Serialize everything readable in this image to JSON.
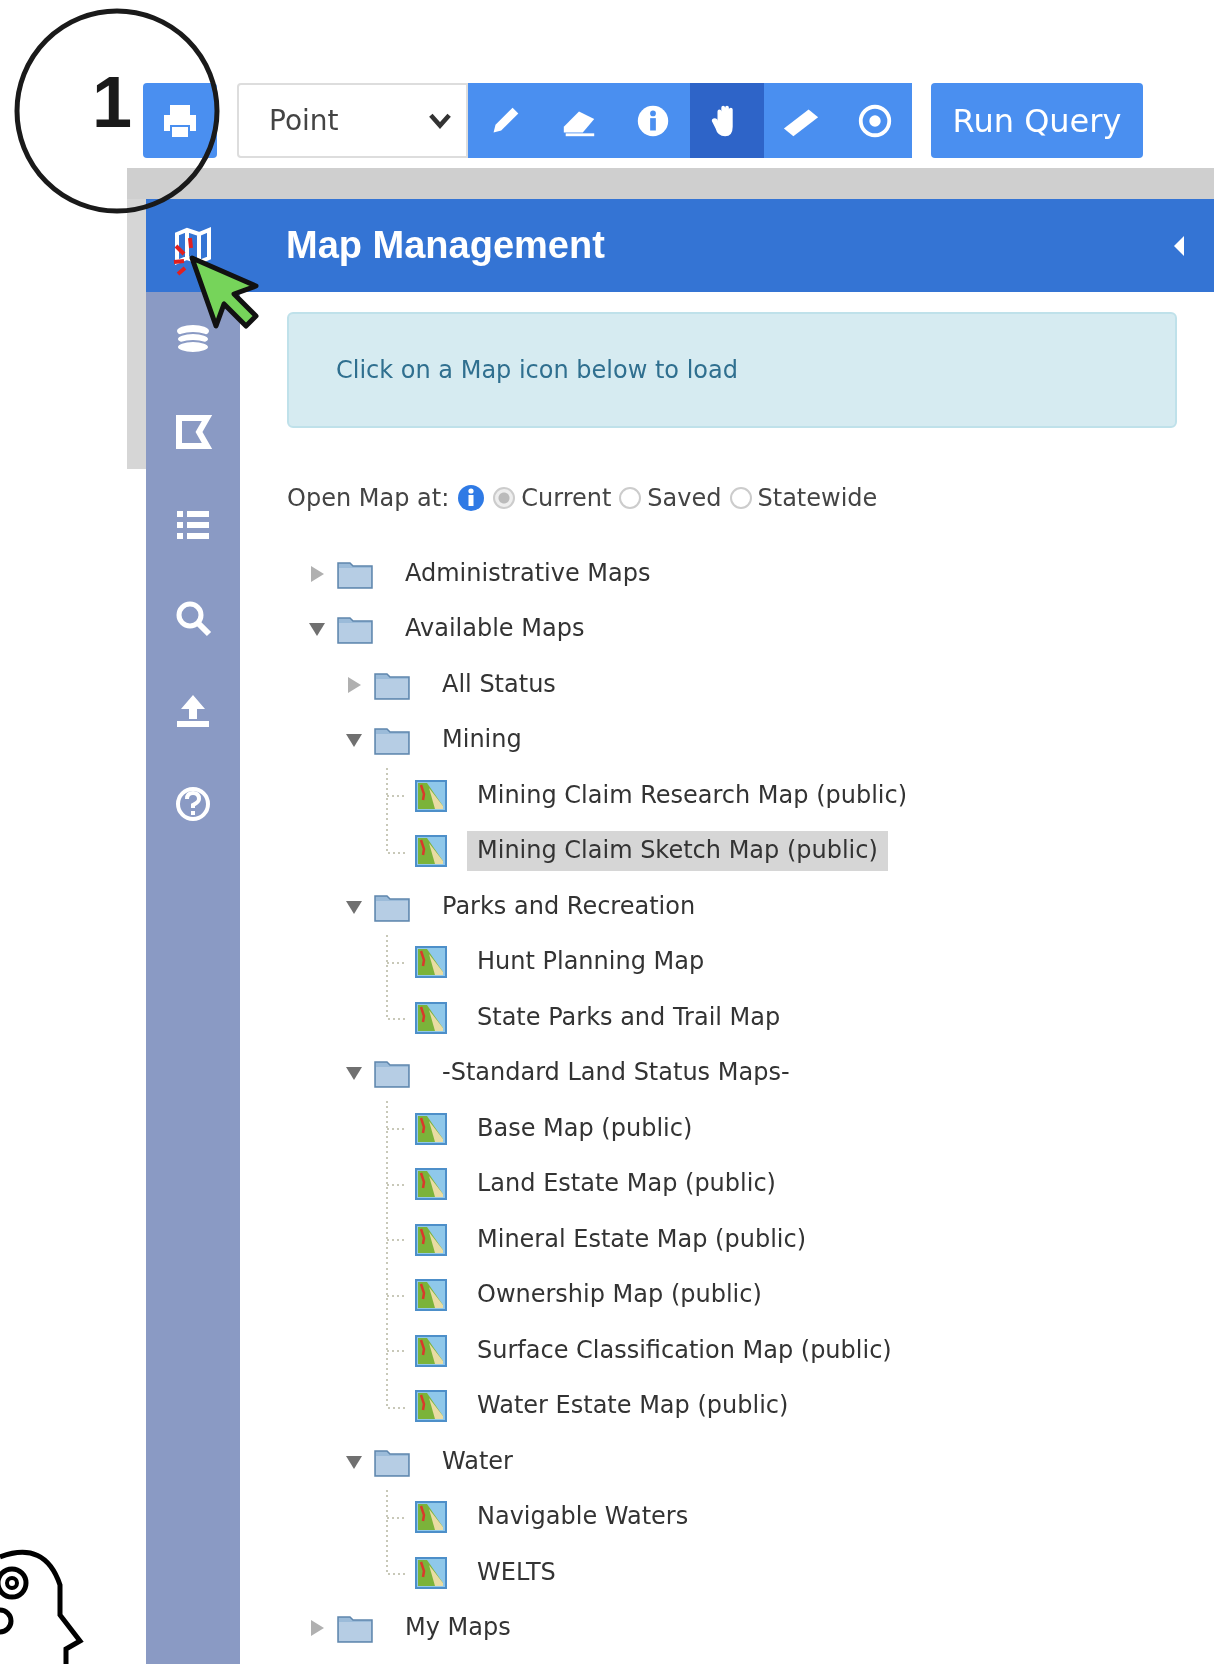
{
  "annotation": {
    "step": "1"
  },
  "toolbar": {
    "geometry": "Point",
    "tools": [
      {
        "selected": false
      },
      {
        "selected": false
      },
      {
        "selected": false
      },
      {
        "selected": true
      },
      {
        "selected": false
      },
      {
        "selected": false
      }
    ],
    "run_button": "Run Query"
  },
  "sidebar_items": [
    {
      "selected": true
    },
    {
      "selected": false
    },
    {
      "selected": false
    },
    {
      "selected": false
    },
    {
      "selected": false
    },
    {
      "selected": false
    },
    {
      "selected": false
    }
  ],
  "panel": {
    "title": "Map Management",
    "info_message": "Click on a Map icon below to load"
  },
  "open_map_at": {
    "label": "Open Map at:",
    "options": [
      {
        "label": "Current",
        "selected": true
      },
      {
        "label": "Saved",
        "selected": false
      },
      {
        "label": "Statewide",
        "selected": false
      }
    ]
  },
  "tree": [
    {
      "kind": "folder",
      "label": "Administrative Maps",
      "expanded": false,
      "selected": false
    },
    {
      "kind": "folder",
      "label": "Available Maps",
      "expanded": true,
      "selected": false,
      "children": [
        {
          "kind": "folder",
          "label": "All Status",
          "expanded": false,
          "selected": false
        },
        {
          "kind": "folder",
          "label": "Mining",
          "expanded": true,
          "selected": false,
          "children": [
            {
              "kind": "map",
              "label": "Mining Claim Research Map (public)",
              "selected": false
            },
            {
              "kind": "map",
              "label": "Mining Claim Sketch Map (public)",
              "selected": true
            }
          ]
        },
        {
          "kind": "folder",
          "label": "Parks and Recreation",
          "expanded": true,
          "selected": false,
          "children": [
            {
              "kind": "map",
              "label": "Hunt Planning Map",
              "selected": false
            },
            {
              "kind": "map",
              "label": "State Parks and Trail Map",
              "selected": false
            }
          ]
        },
        {
          "kind": "folder",
          "label": "-Standard Land Status Maps-",
          "expanded": true,
          "selected": false,
          "children": [
            {
              "kind": "map",
              "label": "Base Map (public)",
              "selected": false
            },
            {
              "kind": "map",
              "label": "Land Estate Map (public)",
              "selected": false
            },
            {
              "kind": "map",
              "label": "Mineral Estate Map (public)",
              "selected": false
            },
            {
              "kind": "map",
              "label": "Ownership Map (public)",
              "selected": false
            },
            {
              "kind": "map",
              "label": "Surface Classification Map (public)",
              "selected": false
            },
            {
              "kind": "map",
              "label": "Water Estate Map (public)",
              "selected": false
            }
          ]
        },
        {
          "kind": "folder",
          "label": "Water",
          "expanded": true,
          "selected": false,
          "children": [
            {
              "kind": "map",
              "label": "Navigable Waters",
              "selected": false
            },
            {
              "kind": "map",
              "label": "WELTS",
              "selected": false
            }
          ]
        }
      ]
    },
    {
      "kind": "folder",
      "label": "My Maps",
      "expanded": false,
      "selected": false
    }
  ]
}
